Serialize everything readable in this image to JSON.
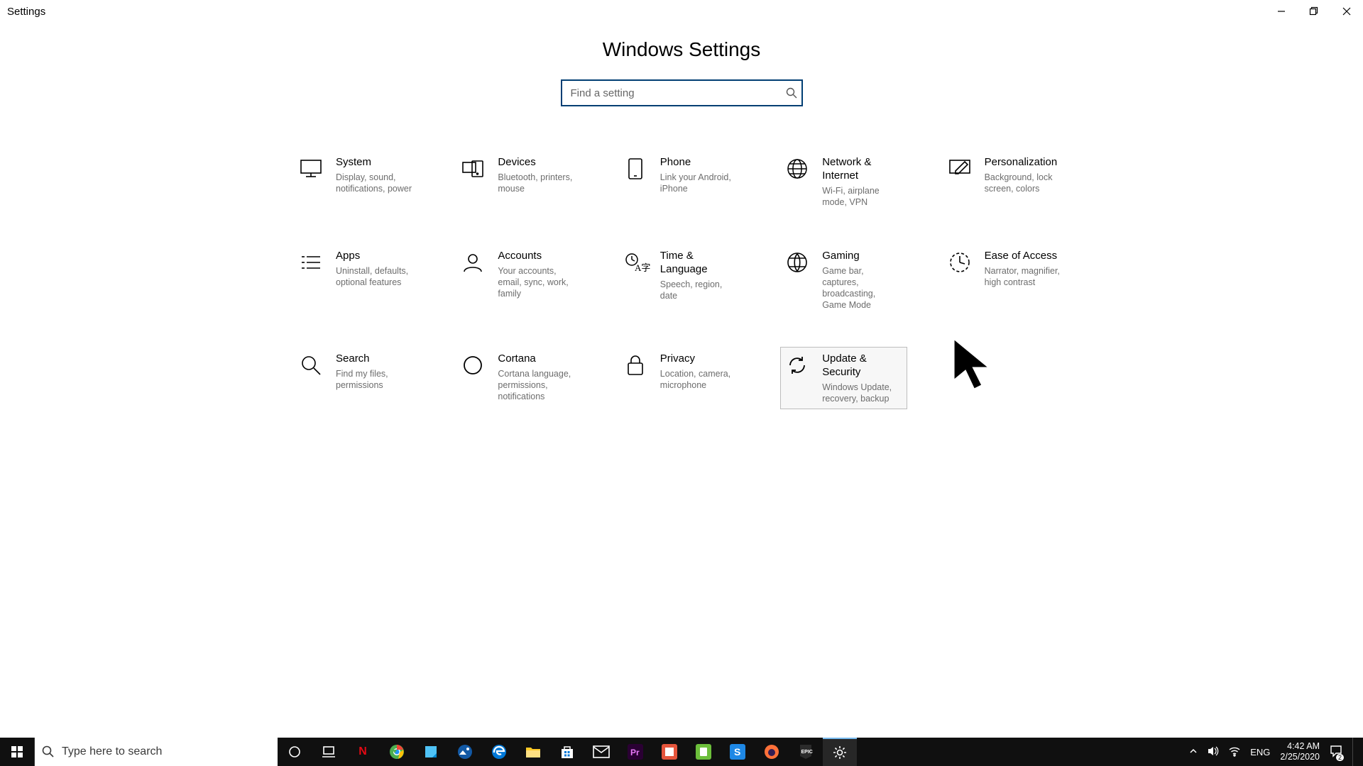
{
  "window": {
    "title": "Settings"
  },
  "page": {
    "heading": "Windows Settings"
  },
  "search": {
    "placeholder": "Find a setting"
  },
  "categories": {
    "system": {
      "title": "System",
      "desc": "Display, sound, notifications, power"
    },
    "devices": {
      "title": "Devices",
      "desc": "Bluetooth, printers, mouse"
    },
    "phone": {
      "title": "Phone",
      "desc": "Link your Android, iPhone"
    },
    "network": {
      "title": "Network & Internet",
      "desc": "Wi-Fi, airplane mode, VPN"
    },
    "personal": {
      "title": "Personalization",
      "desc": "Background, lock screen, colors"
    },
    "apps": {
      "title": "Apps",
      "desc": "Uninstall, defaults, optional features"
    },
    "accounts": {
      "title": "Accounts",
      "desc": "Your accounts, email, sync, work, family"
    },
    "time": {
      "title": "Time & Language",
      "desc": "Speech, region, date"
    },
    "gaming": {
      "title": "Gaming",
      "desc": "Game bar, captures, broadcasting, Game Mode"
    },
    "ease": {
      "title": "Ease of Access",
      "desc": "Narrator, magnifier, high contrast"
    },
    "searchcat": {
      "title": "Search",
      "desc": "Find my files, permissions"
    },
    "cortana": {
      "title": "Cortana",
      "desc": "Cortana language, permissions, notifications"
    },
    "privacy": {
      "title": "Privacy",
      "desc": "Location, camera, microphone"
    },
    "update": {
      "title": "Update & Security",
      "desc": "Windows Update, recovery, backup"
    }
  },
  "taskbar": {
    "search_placeholder": "Type here to search",
    "language": "ENG",
    "time": "4:42 AM",
    "date": "2/25/2020",
    "notification_count": "2"
  }
}
